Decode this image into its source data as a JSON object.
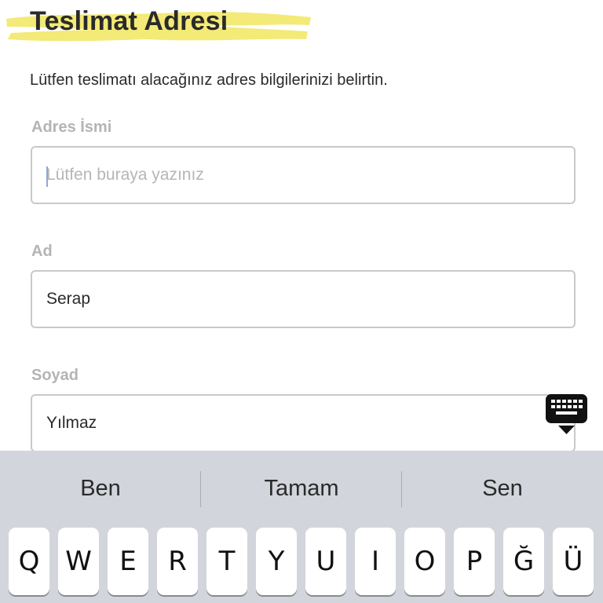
{
  "header": {
    "title": "Teslimat Adresi",
    "highlight_color": "#f1e65f"
  },
  "intro": {
    "text": "Lütfen teslimatı alacağınız adres bilgilerinizi belirtin."
  },
  "form": {
    "address_name": {
      "label": "Adres İsmi",
      "value": "",
      "placeholder": "Lütfen buraya yazınız"
    },
    "first_name": {
      "label": "Ad",
      "value": "Serap"
    },
    "last_name": {
      "label": "Soyad",
      "value": "Yılmaz"
    }
  },
  "keyboard": {
    "toggle_icon": "keyboard-dismiss-icon",
    "suggestions": [
      "Ben",
      "Tamam",
      "Sen"
    ],
    "keys": [
      "Q",
      "W",
      "E",
      "R",
      "T",
      "Y",
      "U",
      "I",
      "O",
      "P",
      "Ğ",
      "Ü"
    ]
  }
}
